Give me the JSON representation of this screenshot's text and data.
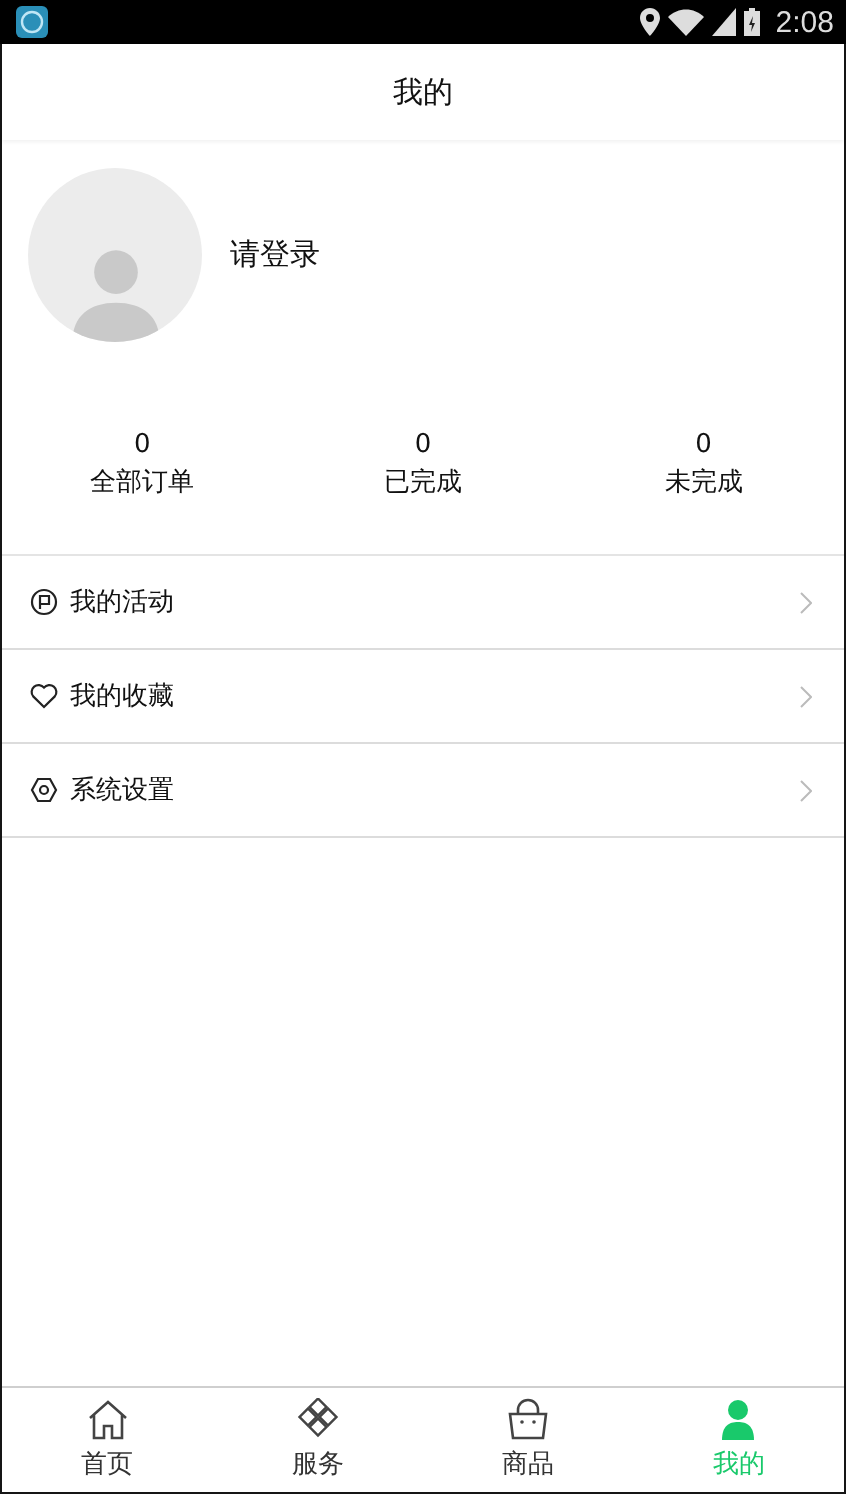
{
  "status_bar": {
    "time": "2:08"
  },
  "header": {
    "title": "我的"
  },
  "profile": {
    "login_label": "请登录"
  },
  "stats": [
    {
      "value": "0",
      "label": "全部订单"
    },
    {
      "value": "0",
      "label": "已完成"
    },
    {
      "value": "0",
      "label": "未完成"
    }
  ],
  "menu": [
    {
      "kind": "activity",
      "label": "我的活动"
    },
    {
      "kind": "favorites",
      "label": "我的收藏"
    },
    {
      "kind": "settings",
      "label": "系统设置"
    }
  ],
  "tabs": [
    {
      "kind": "home",
      "label": "首页",
      "selected": false
    },
    {
      "kind": "services",
      "label": "服务",
      "selected": false
    },
    {
      "kind": "goods",
      "label": "商品",
      "selected": false
    },
    {
      "kind": "me",
      "label": "我的",
      "selected": true
    }
  ]
}
